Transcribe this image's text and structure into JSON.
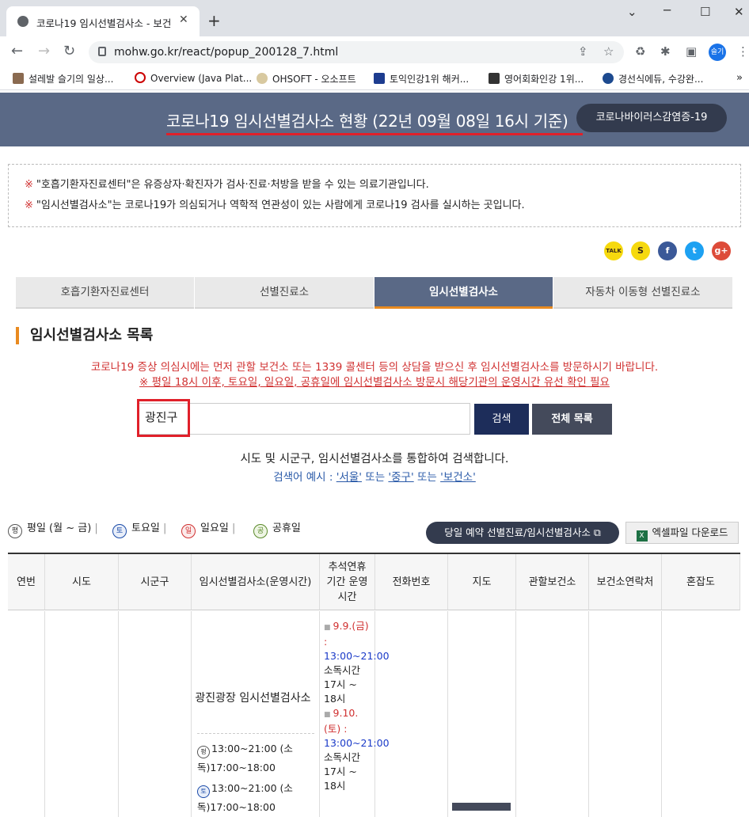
{
  "browser": {
    "tab_title": "코로나19 임시선별검사소 - 보건",
    "url": "mohw.go.kr/react/popup_200128_7.html",
    "profile": "슬기",
    "bookmarks": [
      "설레발 슬기의 일상...",
      "Overview (Java Plat...",
      "OHSOFT - 오소프트",
      "토익인강1위 해커...",
      "영어회화인강 1위...",
      "경선식에듀, 수강완..."
    ]
  },
  "header": {
    "title": "코로나19 임시선별검사소 현황 (22년 09월 08일 16시 기준)",
    "pill": "코로나바이러스감염증-19"
  },
  "notice": {
    "mark": "※",
    "line1": "\"호흡기환자진료센터\"은 유증상자·확진자가 검사·진료·처방을 받을 수 있는 의료기관입니다.",
    "line2": "\"임시선별검사소\"는 코로나19가 의심되거나 역학적 연관성이 있는 사람에게 코로나19 검사를 실시하는 곳입니다."
  },
  "social": [
    "TALK",
    "S",
    "f",
    "t",
    "g+"
  ],
  "tabs": [
    "호흡기환자진료센터",
    "선별진료소",
    "임시선별검사소",
    "자동차 이동형 선별진료소"
  ],
  "section": {
    "title": "임시선별검사소 목록",
    "warn1": "코로나19 증상 의심시에는 먼저 관할 보건소 또는 1339 콜센터 등의 상담을 받으신 후 임시선별검사소를 방문하시기 바랍니다.",
    "warn2": "※ 평일 18시 이후, 토요일, 일요일, 공휴일에 임시선별검사소 방문시 해당기관의 운영시간 유선 확인 필요"
  },
  "search": {
    "value": "광진구",
    "search_btn": "검색",
    "all_btn": "전체 목록",
    "desc": "시도 및 시군구, 임시선별검사소를 통합하여 검색합니다.",
    "example_label": "검색어 예시 :",
    "ex1": "'서울'",
    "or1": "또는",
    "ex2": "'중구'",
    "or2": "또는",
    "ex3": "'보건소'"
  },
  "legend": {
    "weekday_icon": "평",
    "weekday": "평일 (월 ~ 금)",
    "sat_icon": "토",
    "sat": "토요일",
    "sun_icon": "일",
    "sun": "일요일",
    "hol_icon": "공",
    "hol": "공휴일",
    "sep": "|"
  },
  "buttons": {
    "reserve": "당일 예약 선별진료/임시선별검사소",
    "excel": "엑셀파일 다운로드"
  },
  "table": {
    "headers": [
      "연번",
      "시도",
      "시군구",
      "임시선별검사소(운영시간)",
      "추석연휴 기간 운영시간",
      "전화번호",
      "지도",
      "관할보건소",
      "보건소연락처",
      "혼잡도"
    ],
    "row": {
      "name": "광진광장 임시선별검사소",
      "weekday_hours": "13:00~21:00 (소독)17:00~18:00",
      "sat_hours": "13:00~21:00 (소독)17:00~18:00",
      "hol1_date": "9.9.(금) :",
      "hol1_time": "13:00~21:00",
      "hol1_note": "소독시간 17시 ~ 18시",
      "hol2_date": "9.10.(토) :",
      "hol2_time": "13:00~21:00",
      "hol2_note": "소독시간 17시 ~ 18시"
    }
  }
}
